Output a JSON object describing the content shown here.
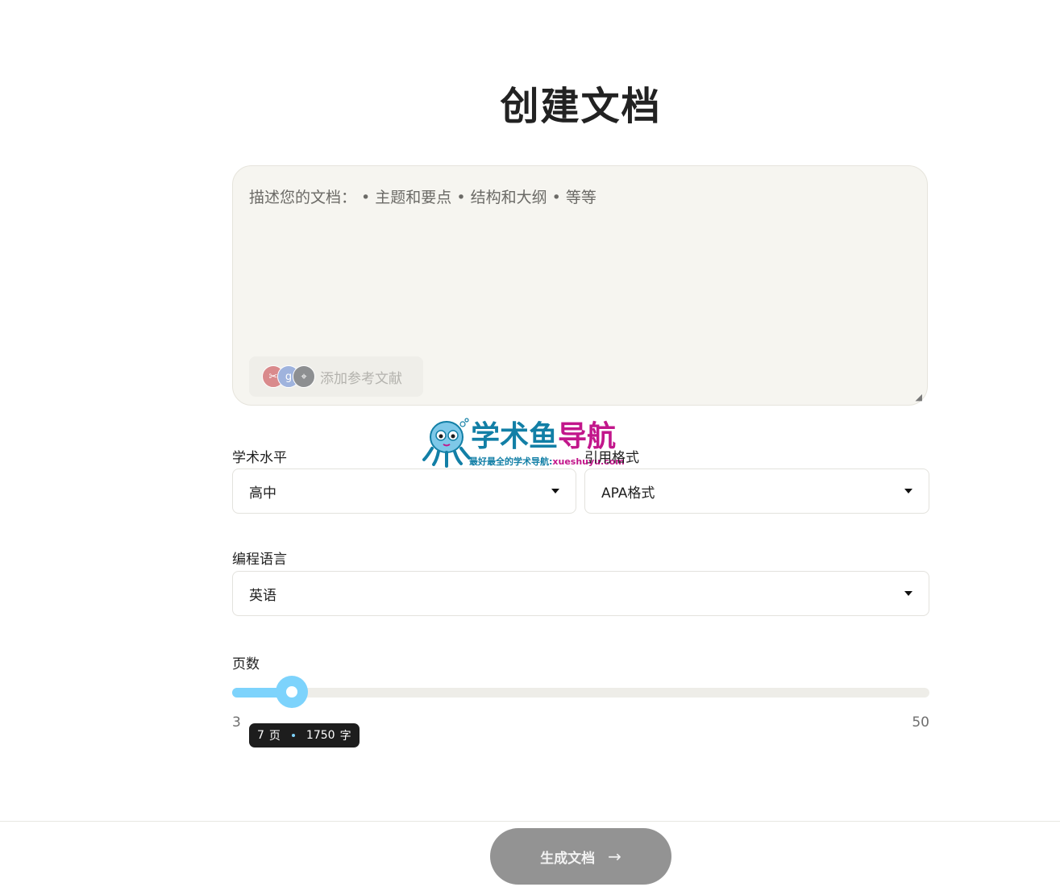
{
  "page": {
    "title": "创建文档"
  },
  "description": {
    "placeholder": "描述您的文档：  • 主题和要点 • 结构和大纲 • 等等",
    "add_reference_label": "添加参考文献",
    "reference_icons": [
      "scissors-icon",
      "google-scholar-icon",
      "pin-icon"
    ]
  },
  "academic_level": {
    "label": "学术水平",
    "value": "高中"
  },
  "citation_style": {
    "label": "引用格式",
    "value": "APA格式"
  },
  "language": {
    "label": "编程语言",
    "value": "英语"
  },
  "pages": {
    "label": "页数",
    "min": 3,
    "max": 50,
    "min_label": "3",
    "max_label": "50",
    "value": 7,
    "tooltip_pages": "7",
    "tooltip_pages_unit": "页",
    "tooltip_words": "1750",
    "tooltip_words_unit": "字"
  },
  "watermark": {
    "title_part1": "学术鱼",
    "title_part2": "导航",
    "subtitle_part1": "最好最全的学术导航:",
    "subtitle_part2": "xueshuyu.com"
  },
  "footer": {
    "generate_label": "生成文档",
    "generate_arrow": "→"
  },
  "colors": {
    "accent": "#7dd3fc",
    "button_disabled": "#939393",
    "watermark_blue": "#127fa6",
    "watermark_pink": "#c2168b"
  }
}
